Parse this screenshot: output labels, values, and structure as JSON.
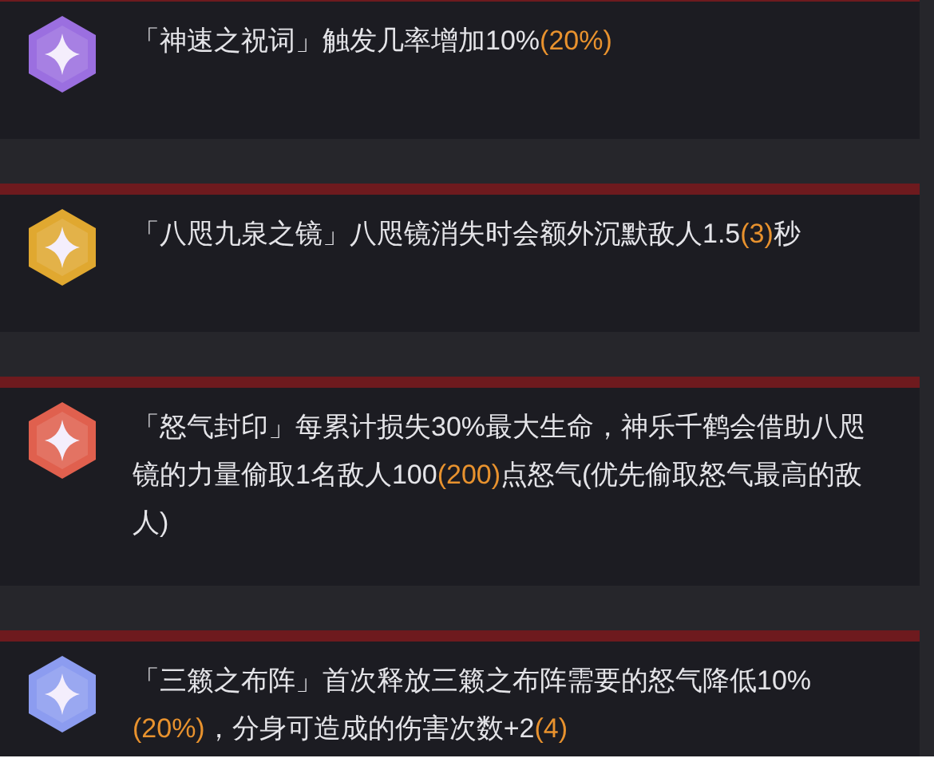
{
  "talents": [
    {
      "color": "#9b6fe0",
      "segments": [
        {
          "text": "「神速之祝词」触发几率增加10%",
          "highlight": false
        },
        {
          "text": "(20%)",
          "highlight": true
        }
      ]
    },
    {
      "color": "#e0a830",
      "segments": [
        {
          "text": "「八咫九泉之镜」八咫镜消失时会额外沉默敌人1.5",
          "highlight": false
        },
        {
          "text": "(3)",
          "highlight": true
        },
        {
          "text": "秒",
          "highlight": false
        }
      ]
    },
    {
      "color": "#e0604e",
      "segments": [
        {
          "text": "「怒气封印」每累计损失30%最大生命，神乐千鹤会借助八咫镜的力量偷取1名敌人100",
          "highlight": false
        },
        {
          "text": "(200)",
          "highlight": true
        },
        {
          "text": "点怒气(优先偷取怒气最高的敌人)",
          "highlight": false
        }
      ]
    },
    {
      "color": "#8c9cf0",
      "segments": [
        {
          "text": "「三籁之布阵」首次释放三籁之布阵需要的怒气降低10%",
          "highlight": false
        },
        {
          "text": "(20%)",
          "highlight": true
        },
        {
          "text": "，分身可造成的伤害次数+2",
          "highlight": false
        },
        {
          "text": "(4)",
          "highlight": true
        }
      ]
    }
  ]
}
